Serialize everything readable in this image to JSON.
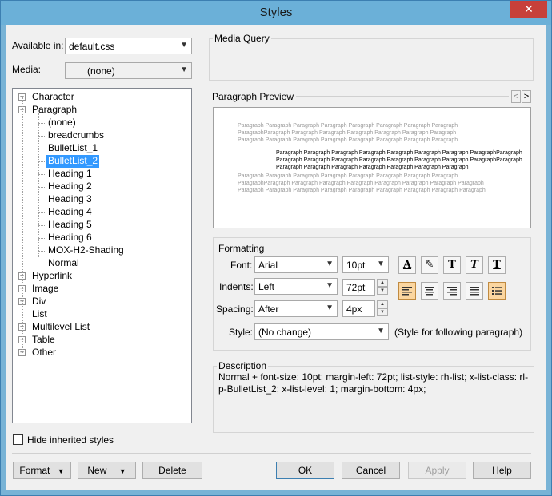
{
  "window": {
    "title": "Styles",
    "close_glyph": "✕"
  },
  "available_in": {
    "label": "Available in:",
    "value": "default.css"
  },
  "media": {
    "label": "Media:",
    "value": "(none)"
  },
  "tree": {
    "items": [
      {
        "label": "Character",
        "expander": "+"
      },
      {
        "label": "Paragraph",
        "expander": "−"
      },
      {
        "label": "(none)"
      },
      {
        "label": "breadcrumbs"
      },
      {
        "label": "BulletList_1"
      },
      {
        "label": "BulletList_2",
        "selected": true
      },
      {
        "label": "Heading 1"
      },
      {
        "label": "Heading 2"
      },
      {
        "label": "Heading 3"
      },
      {
        "label": "Heading 4"
      },
      {
        "label": "Heading 5"
      },
      {
        "label": "Heading 6"
      },
      {
        "label": "MOX-H2-Shading"
      },
      {
        "label": "Normal"
      },
      {
        "label": "Hyperlink",
        "expander": "+"
      },
      {
        "label": "Image",
        "expander": "+"
      },
      {
        "label": "Div",
        "expander": "+"
      },
      {
        "label": "List"
      },
      {
        "label": "Multilevel List",
        "expander": "+"
      },
      {
        "label": "Table",
        "expander": "+"
      },
      {
        "label": "Other",
        "expander": "+"
      }
    ]
  },
  "hide_inherited": {
    "label": "Hide inherited styles"
  },
  "media_query": {
    "title": "Media Query"
  },
  "paragraph_preview": {
    "title": "Paragraph Preview",
    "prev_glyph": "<",
    "next_glyph": ">",
    "gray_before": "Paragraph Paragraph Paragraph Paragraph Paragraph Paragraph Paragraph Paragraph ParagraphParagraph Paragraph Paragraph Paragraph Paragraph Paragraph Paragraph Paragraph Paragraph Paragraph Paragraph Paragraph Paragraph Paragraph Paragraph",
    "black": "Paragraph Paragraph Paragraph Paragraph Paragraph Paragraph Paragraph ParagraphParagraph Paragraph Paragraph Paragraph Paragraph Paragraph Paragraph Paragraph ParagraphParagraph Paragraph Paragraph Paragraph Paragraph Paragraph Paragraph Paragraph",
    "gray_after": "Paragraph Paragraph Paragraph Paragraph Paragraph Paragraph Paragraph Paragraph ParagraphParagraph Paragraph Paragraph Paragraph Paragraph Paragraph Paragraph Paragraph Paragraph Paragraph Paragraph Paragraph Paragraph Paragraph Paragraph Paragraph Paragraph"
  },
  "formatting": {
    "title": "Formatting",
    "font_label": "Font:",
    "font_value": "Arial",
    "font_size": "10pt",
    "indents_label": "Indents:",
    "indents_value": "Left",
    "indents_size": "72pt",
    "spacing_label": "Spacing:",
    "spacing_value": "After",
    "spacing_size": "4px",
    "style_label": "Style:",
    "style_value": "(No change)",
    "style_note": "(Style for following paragraph)",
    "tool_glyphs": {
      "font_color": "A",
      "highlight": "✎",
      "bold": "T",
      "italic": "T",
      "underline": "T"
    }
  },
  "description": {
    "title": "Description",
    "text": "Normal + font-size: 10pt;  margin-left: 72pt;  list-style: rh-list;  x-list-class: rl-p-BulletList_2;  x-list-level: 1;  margin-bottom: 4px;"
  },
  "buttons": {
    "format": "Format",
    "new": "New",
    "delete": "Delete",
    "ok": "OK",
    "cancel": "Cancel",
    "apply": "Apply",
    "help": "Help"
  },
  "colors": {
    "selection": "#3399ff",
    "active_tool": "#fbd6a0",
    "close": "#c7403a"
  }
}
